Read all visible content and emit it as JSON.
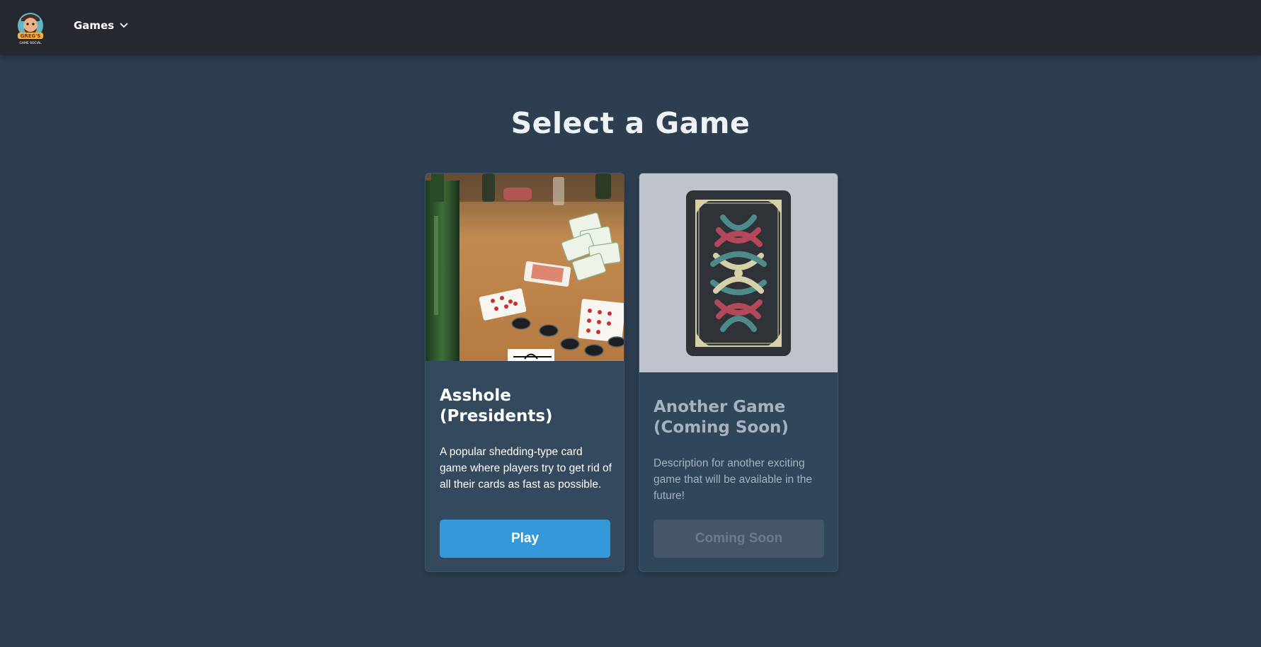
{
  "nav": {
    "logo_text_line1": "GREG'S",
    "logo_text_line2": "GAME SOCIAL",
    "games_menu_label": "Games"
  },
  "main": {
    "title": "Select a Game",
    "games": [
      {
        "title": "Asshole (Presidents)",
        "description": "A popular shedding-type card game where players try to get rid of all their cards as fast as possible.",
        "button_label": "Play",
        "status": "available"
      },
      {
        "title": "Another Game (Coming Soon)",
        "description": "Description for another exciting game that will be available in the future!",
        "button_label": "Coming Soon",
        "status": "disabled"
      }
    ]
  },
  "colors": {
    "background": "#2c3e50",
    "topbar": "#25292f",
    "card": "#34495e",
    "accent": "#3498db",
    "disabled_button": "#445667"
  },
  "icons": {
    "menu_chevron": "chevron-down-icon",
    "logo": "greg-mascot-logo"
  }
}
